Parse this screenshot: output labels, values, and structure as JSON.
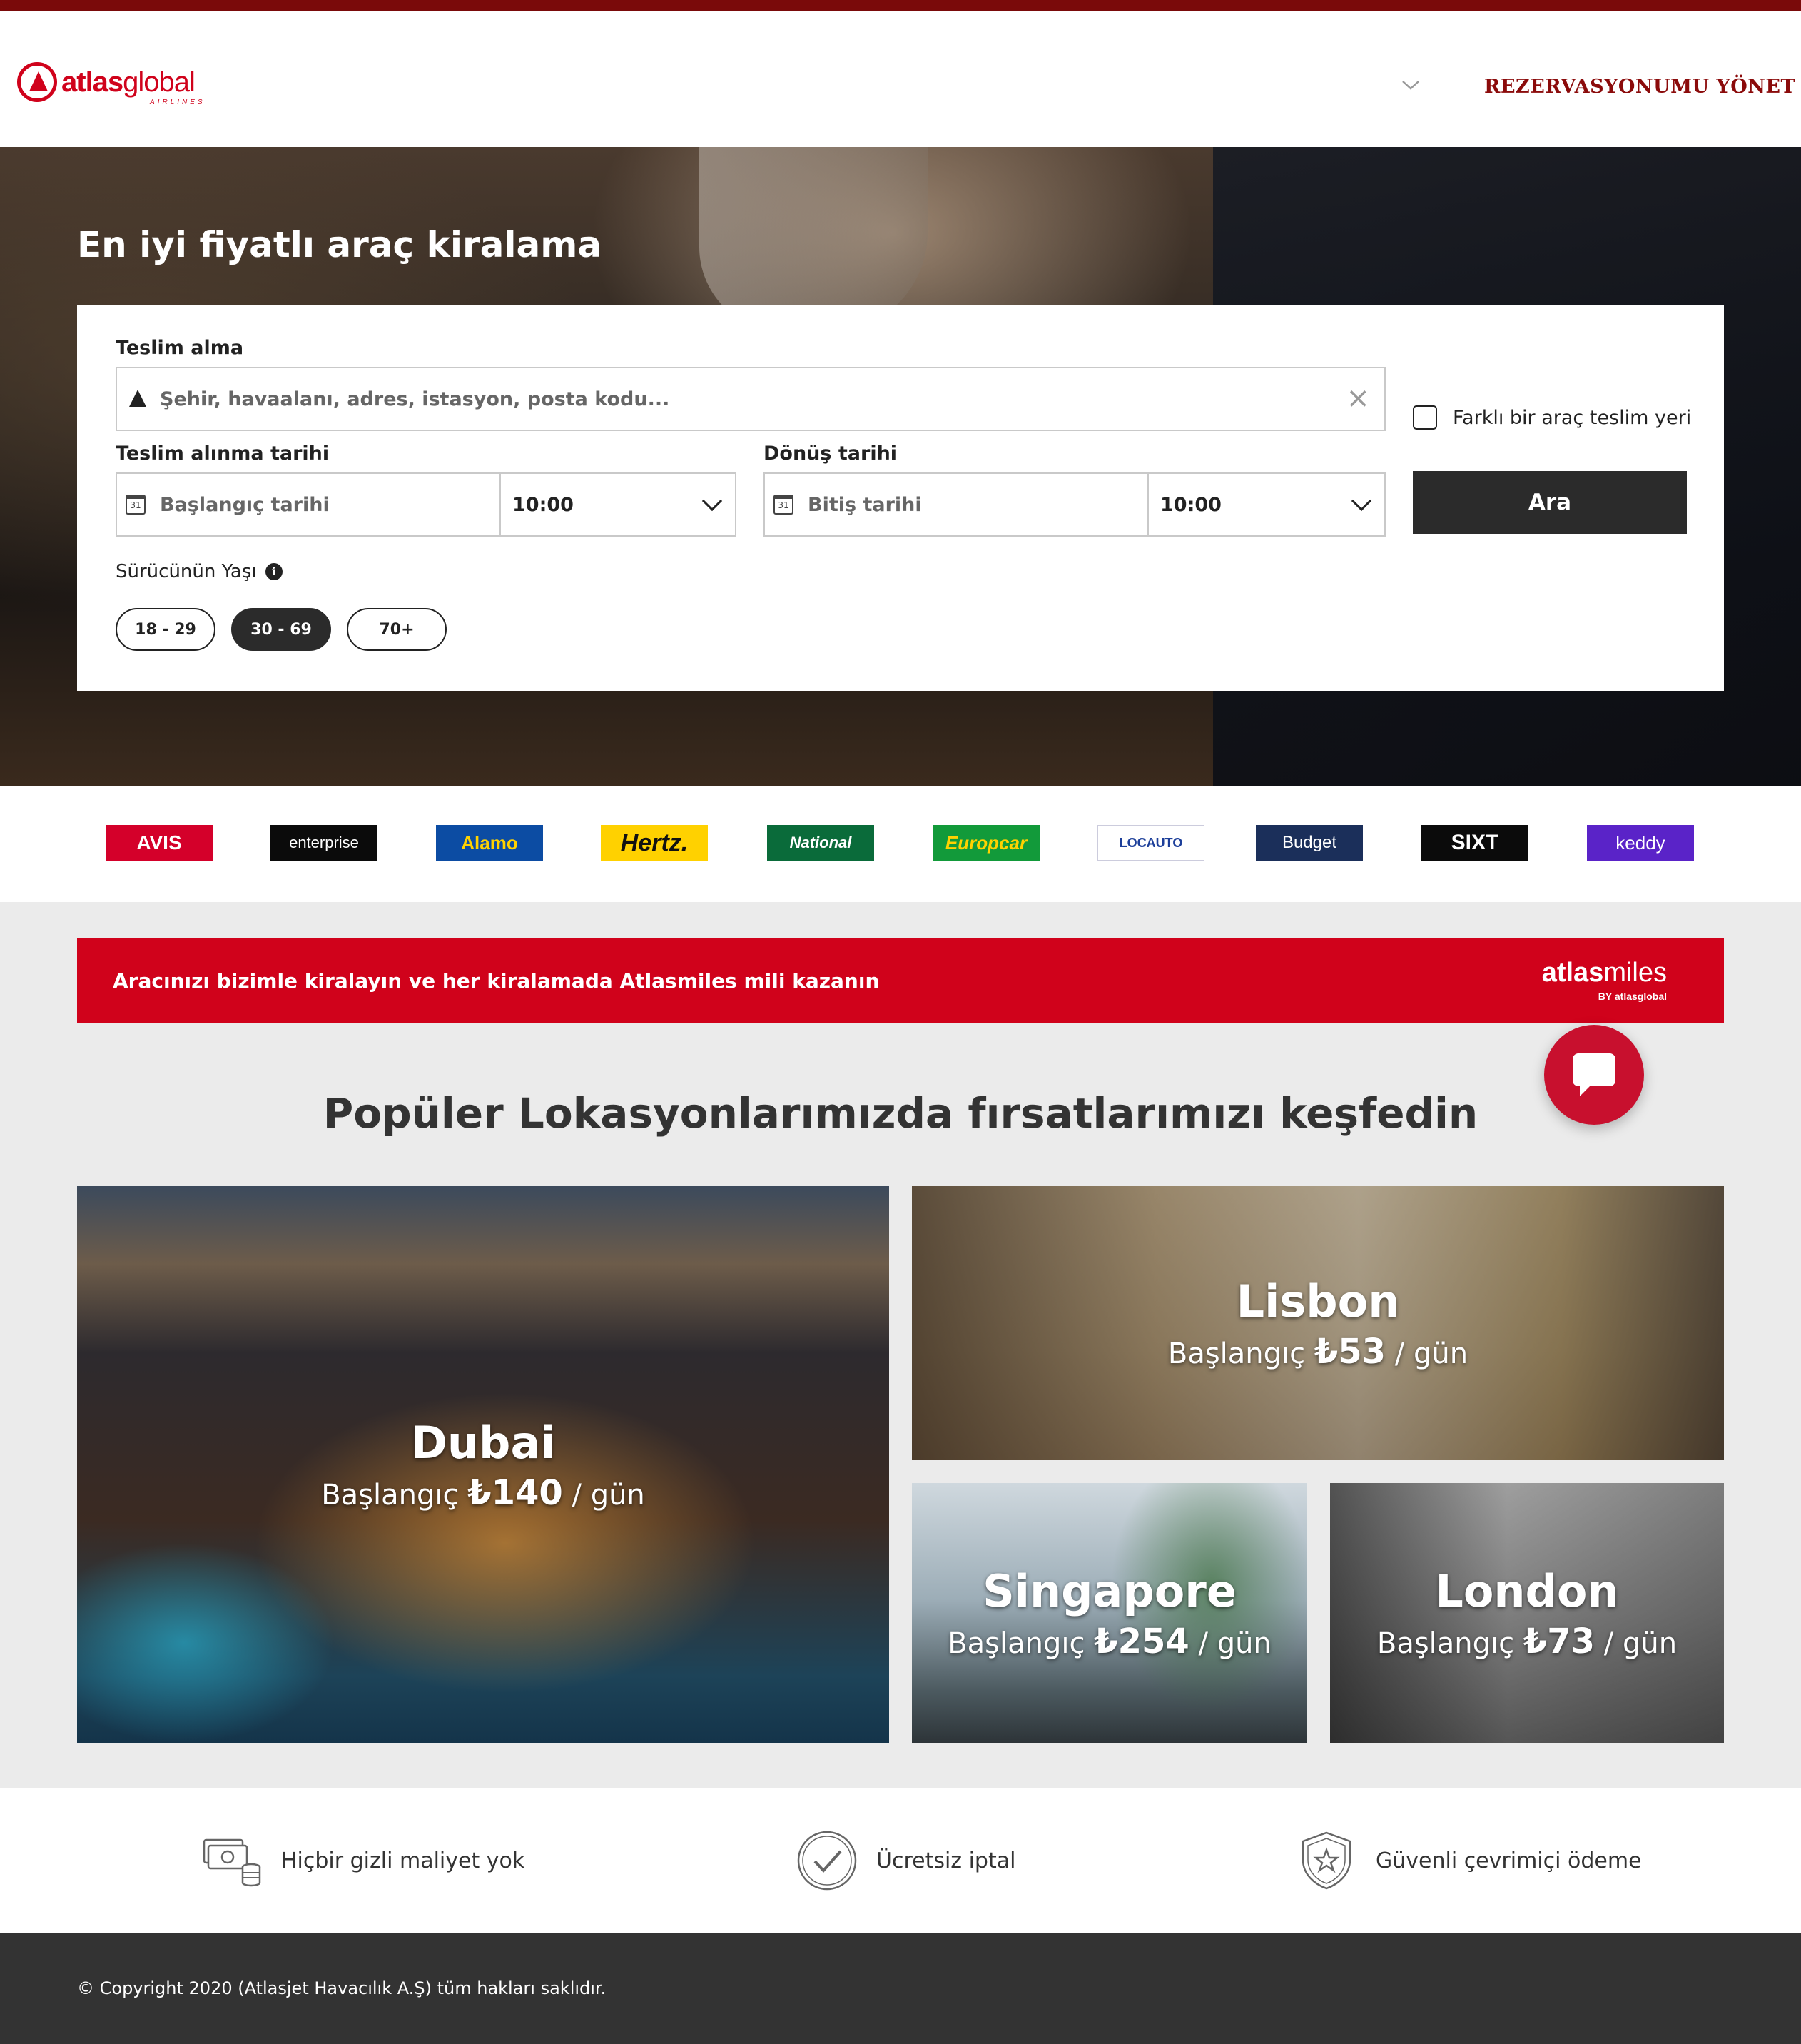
{
  "header": {
    "logo_text_bold": "atlas",
    "logo_text_light": "global",
    "logo_sub": "AIRLINES",
    "manage_booking": "REZERVASYONUMU YÖNET"
  },
  "hero": {
    "title": "En iyi fiyatlı araç kiralama"
  },
  "search": {
    "pickup_label": "Teslim alma",
    "pickup_placeholder": "Şehir, havaalanı, adres, istasyon, posta kodu...",
    "different_dropoff_label": "Farklı bir araç teslim yeri",
    "pickup_date_label": "Teslim alınma tarihi",
    "pickup_date_placeholder": "Başlangıç tarihi",
    "pickup_time": "10:00",
    "return_date_label": "Dönüş tarihi",
    "return_date_placeholder": "Bitiş tarihi",
    "return_time": "10:00",
    "search_button": "Ara",
    "age_label": "Sürücünün Yaşı",
    "age_options": [
      "18 - 29",
      "30 - 69",
      "70+"
    ],
    "age_selected": "30 - 69",
    "calendar_glyph": "31"
  },
  "partners": [
    "AVIS",
    "enterprise",
    "Alamo",
    "Hertz.",
    "National",
    "Europcar",
    "LOCAUTO",
    "Budget",
    "SIXT",
    "keddy"
  ],
  "promo": {
    "text": "Aracınızı bizimle kiralayın ve her kiralamada Atlasmiles mili kazanın",
    "logo_bold": "atlas",
    "logo_light": "miles",
    "logo_sub": "BY atlasglobal"
  },
  "locations": {
    "title": "Popüler Lokasyonlarımızda fırsatlarımızı keşfedin",
    "items": [
      {
        "name": "Dubai",
        "prefix": "Başlangıç",
        "price": "₺140",
        "unit": "/ gün"
      },
      {
        "name": "Lisbon",
        "prefix": "Başlangıç",
        "price": "₺53",
        "unit": "/ gün"
      },
      {
        "name": "Singapore",
        "prefix": "Başlangıç",
        "price": "₺254",
        "unit": "/ gün"
      },
      {
        "name": "London",
        "prefix": "Başlangıç",
        "price": "₺73",
        "unit": "/ gün"
      }
    ]
  },
  "features": [
    {
      "icon": "money-icon",
      "text": "Hiçbir gizli maliyet yok"
    },
    {
      "icon": "check-circle-icon",
      "text": "Ücretsiz iptal"
    },
    {
      "icon": "shield-star-icon",
      "text": "Güvenli çevrimiçi ödeme"
    }
  ],
  "footer": {
    "copyright": "© Copyright 2020 (Atlasjet Havacılık A.Ş) tüm hakları saklıdır."
  },
  "colors": {
    "brand_red": "#d0021b",
    "dark_red": "#8b0b0b",
    "button_dark": "#2b2b2b",
    "footer_bg": "#333333"
  }
}
